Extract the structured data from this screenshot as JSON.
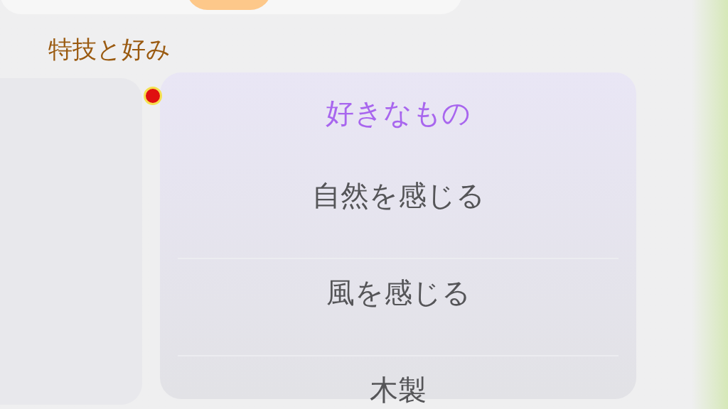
{
  "section_title": "特技と好み",
  "likes": {
    "heading": "好きなもの",
    "items": [
      "自然を感じる",
      "風を感じる",
      "木製"
    ]
  }
}
